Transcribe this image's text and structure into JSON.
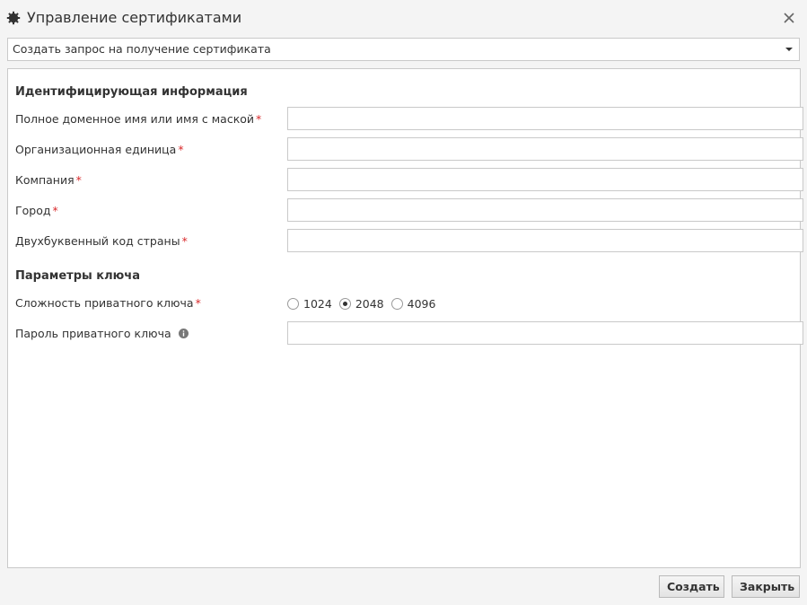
{
  "window": {
    "title": "Управление сертификатами",
    "title_icon": "gear-icon",
    "close_icon": "close-icon"
  },
  "action_select": {
    "selected": "Создать запрос на получение сертификата"
  },
  "identity_section": {
    "title": "Идентифицирующая информация",
    "fields": [
      {
        "label": "Полное доменное имя или имя с маской",
        "required": "*",
        "value": ""
      },
      {
        "label": "Организационная единица",
        "required": "*",
        "value": ""
      },
      {
        "label": "Компания",
        "required": "*",
        "value": ""
      },
      {
        "label": "Город",
        "required": "*",
        "value": ""
      },
      {
        "label": "Двухбуквенный код страны",
        "required": "*",
        "value": ""
      }
    ]
  },
  "key_section": {
    "title": "Параметры ключа",
    "complexity": {
      "label": "Сложность приватного ключа",
      "required": "*",
      "options": [
        "1024",
        "2048",
        "4096"
      ],
      "selected": "2048"
    },
    "password": {
      "label": "Пароль приватного ключа",
      "info_icon": "info-icon",
      "value": ""
    }
  },
  "footer": {
    "create_label": "Создать",
    "close_label": "Закрыть"
  },
  "colors": {
    "required": "#d9292b",
    "border": "#c9c9c9",
    "background": "#f4f4f4"
  }
}
